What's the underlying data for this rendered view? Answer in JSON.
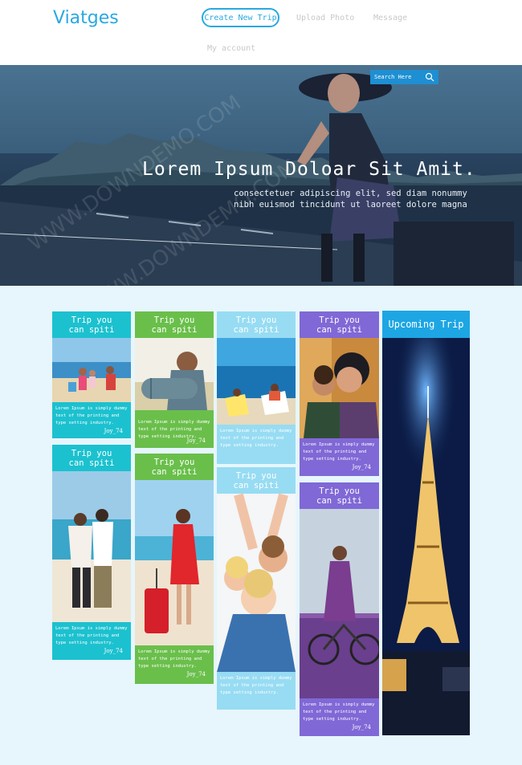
{
  "brand": {
    "logo": "Viatges",
    "accent": "#29a9e1"
  },
  "nav": {
    "create_trip": "Create New Trip",
    "upload_photo": "Upload Photo",
    "message": "Message",
    "my_account": "My account"
  },
  "hero": {
    "search_placeholder": "Search Here",
    "title": "Lorem Ipsum Doloar Sit Amit.",
    "subtitle_line1": "consectetuer adipiscing elit, sed diam nonummy",
    "subtitle_line2": "nibh euismod tincidunt ut laoreet dolore magna",
    "watermark": "WWW.DOWNDEMO.COM"
  },
  "cards": {
    "heading": "Trip you can spiti",
    "text_line1": "Lorem Ipsum is simply dummy",
    "text_line2": "text of the printing and",
    "text_line3": "type setting industry.",
    "author": "Joy_74"
  },
  "upcoming": {
    "title": "Upcoming Trip"
  },
  "colors": {
    "teal": "#1cc1cf",
    "green": "#6abf4b",
    "sky": "#97dcf3",
    "purple": "#8068d6",
    "blue": "#1da6e3"
  }
}
